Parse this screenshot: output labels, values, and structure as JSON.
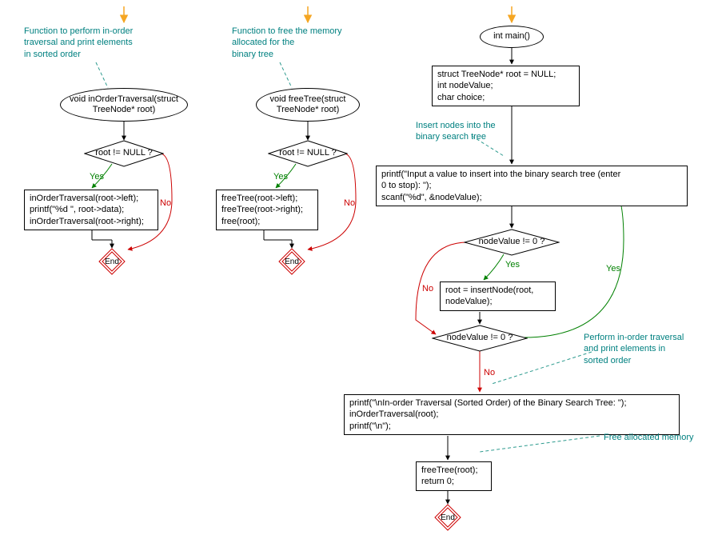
{
  "colors": {
    "comment": "#008080",
    "yes": "#008000",
    "no": "#cc0000",
    "arrowStart": "#f5a623",
    "commentLine": "#2e9b8f"
  },
  "flow1": {
    "comment": "Function to perform in-order\ntraversal and print elements\nin sorted order",
    "start": "void inOrderTraversal(struct\nTreeNode* root)",
    "cond": "root != NULL ?",
    "yesLabel": "Yes",
    "noLabel": "No",
    "body": "inOrderTraversal(root->left);\nprintf(\"%d \", root->data);\ninOrderTraversal(root->right);",
    "end": "End"
  },
  "flow2": {
    "comment": "Function to free the memory\nallocated for the\nbinary tree",
    "start": "void freeTree(struct\nTreeNode* root)",
    "cond": "root != NULL ?",
    "yesLabel": "Yes",
    "noLabel": "No",
    "body": "freeTree(root->left);\nfreeTree(root->right);\nfree(root);",
    "end": "End"
  },
  "flow3": {
    "start": "int main()",
    "decls": "struct TreeNode* root = NULL;\nint nodeValue;\nchar choice;",
    "comment1": "Insert nodes into the\nbinary search tree",
    "prompt": "printf(\"Input a value to insert into the binary search tree (enter\n0 to stop): \");\nscanf(\"%d\", &nodeValue);",
    "cond1": "nodeValue != 0 ?",
    "yesLabel": "Yes",
    "noLabel": "No",
    "insert": "root = insertNode(root,\nnodeValue);",
    "cond2": "nodeValue != 0 ?",
    "comment2": "Perform in-order traversal\nand print elements in\nsorted order",
    "traversal": "printf(\"\\nIn-order Traversal (Sorted Order) of the Binary Search Tree: \");\ninOrderTraversal(root);\nprintf(\"\\n\");",
    "comment3": "Free allocated memory",
    "free": "freeTree(root);\nreturn 0;",
    "end": "End"
  }
}
